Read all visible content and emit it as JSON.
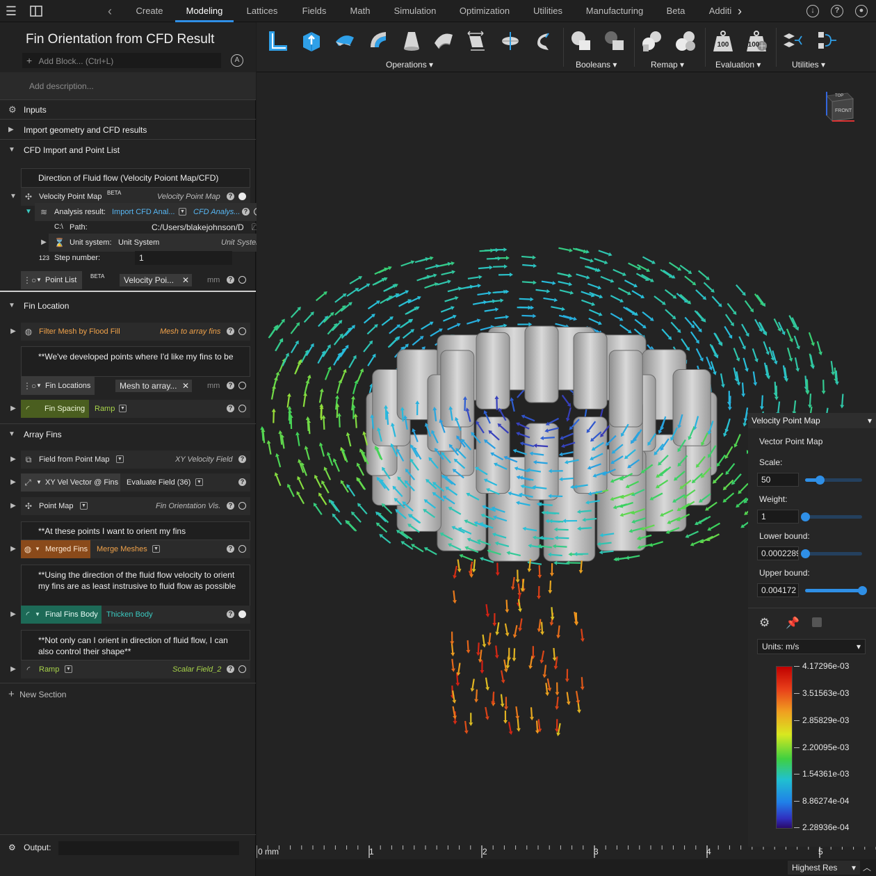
{
  "nav": {
    "tabs": [
      {
        "label": "Create"
      },
      {
        "label": "Modeling"
      },
      {
        "label": "Lattices"
      },
      {
        "label": "Fields"
      },
      {
        "label": "Math"
      },
      {
        "label": "Simulation"
      },
      {
        "label": "Optimization"
      },
      {
        "label": "Utilities"
      },
      {
        "label": "Manufacturing"
      },
      {
        "label": "Beta"
      },
      {
        "label": "Additi"
      }
    ],
    "active_tab": "Modeling"
  },
  "project": {
    "title": "Fin Orientation from CFD Result",
    "add_block_placeholder": "Add Block... (Ctrl+L)",
    "description_placeholder": "Add description..."
  },
  "sections": {
    "inputs": "Inputs",
    "import": "Import geometry and CFD results",
    "cfd": "CFD Import and Point List",
    "fin_location": "Fin Location",
    "array_fins": "Array Fins",
    "new_section": "New Section"
  },
  "cfd_block": {
    "note": "Direction of Fluid flow (Velocity Poiont Map/CFD)",
    "vpm_name": "Velocity Point Map",
    "vpm_badge": "BETA",
    "vpm_right": "Velocity Point Map",
    "analysis_label": "Analysis result:",
    "analysis_value": "Import CFD Anal...",
    "analysis_right": "CFD Analys...",
    "path_prefix": "C:\\",
    "path_label": "Path:",
    "path_value": "C:/Users/blakejohnson/D",
    "unit_label": "Unit system:",
    "unit_value": "Unit System",
    "unit_right": "Unit System",
    "step_prefix": "123",
    "step_label": "Step number:",
    "step_value": "1",
    "point_list": "Point List",
    "point_list_badge": "BETA",
    "point_list_chip": "Velocity Poi...",
    "point_list_unit": "mm"
  },
  "fin_location": {
    "filter_name": "Filter Mesh by Flood Fill",
    "filter_right": "Mesh to array fins",
    "note": "**We've developed points where I'd like my fins to be",
    "fin_locations": "Fin Locations",
    "fin_locations_chip": "Mesh to array...",
    "fin_locations_unit": "mm",
    "fin_spacing": "Fin Spacing",
    "fin_spacing_value": "Ramp"
  },
  "array_fins": {
    "field_name": "Field from Point Map",
    "field_right": "XY Velocity Field",
    "xyvel_name": "XY Vel Vector @ Fins",
    "xyvel_value": "Evaluate Field (36)",
    "pointmap_name": "Point Map",
    "pointmap_right": "Fin Orientation Vis.",
    "note1": "**At these points I want to orient my fins",
    "merged_name": "Merged Fins",
    "merged_value": "Merge Meshes",
    "note2": "**Using the direction of the fluid flow velocity to orient my fins are as least instrusive to fluid flow as possible",
    "final_name": "Final Fins Body",
    "final_value": "Thicken Body",
    "note3": "**Not only can I orient in direction of fluid flow, I can also control their shape**",
    "ramp_name": "Ramp",
    "ramp_right": "Scalar Field_2"
  },
  "output": {
    "label": "Output:"
  },
  "toolbar": {
    "groups": [
      "Operations",
      "Booleans",
      "Remap",
      "Evaluation",
      "Utilities"
    ],
    "weight_label": "100"
  },
  "viewcube": {
    "face": "FRONT",
    "top": "TOP"
  },
  "overlay": {
    "title": "Velocity Point Map",
    "subtitle": "Vector Point Map",
    "scale_label": "Scale:",
    "scale_value": "50",
    "scale_fraction": 0.25,
    "weight_label": "Weight:",
    "weight_value": "1",
    "weight_fraction": 0.0,
    "lower_label": "Lower bound:",
    "lower_value": "0.0002289",
    "lower_fraction": 0.0,
    "upper_label": "Upper bound:",
    "upper_value": "0.004172",
    "upper_fraction": 1.0,
    "units": "Units: m/s",
    "legend_ticks": [
      "4.17296e-03",
      "3.51563e-03",
      "2.85829e-03",
      "2.20095e-03",
      "1.54361e-03",
      "8.86274e-04",
      "2.28936e-04"
    ]
  },
  "ruler": {
    "labels": [
      "0 mm",
      "1",
      "2",
      "3",
      "4",
      "5"
    ]
  },
  "render_quality": "Highest Res",
  "colors": {
    "accent": "#2f8fe6",
    "orange": "#f0a24a",
    "green": "#a8d44a",
    "teal": "#3bc9c0"
  }
}
